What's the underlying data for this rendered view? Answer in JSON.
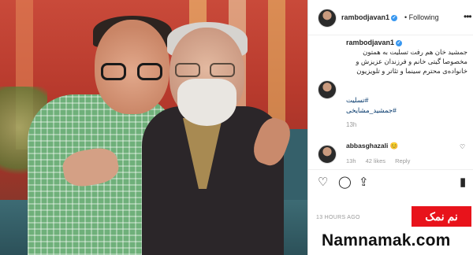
{
  "post": {
    "author": "rambodjavan1",
    "follow_label": "Following",
    "more_icon": "more-dots-icon",
    "caption": "جمشید خان هم رفت تسلیت به همتون مخصوصا گیتی خانم و فرزندان عزیزش و خانواده‌ی محترم سینما و تئاتر و تلویزیون",
    "hashtags": [
      "#تسلیت",
      "#جمشید_مشایخی"
    ],
    "caption_time": "13h"
  },
  "comment": {
    "author": "abbasghazali",
    "emoji": "😊",
    "time": "13h",
    "likes": "42 likes",
    "reply": "Reply"
  },
  "actions": {
    "like_icon": "heart-icon",
    "comment_icon": "comment-icon",
    "share_icon": "share-icon",
    "save_icon": "bookmark-icon"
  },
  "posted_ago": "13 HOURS AGO",
  "watermark": {
    "badge_text": "نم نمک",
    "url": "Namnamak.com",
    "badge_color": "#e8131b"
  }
}
